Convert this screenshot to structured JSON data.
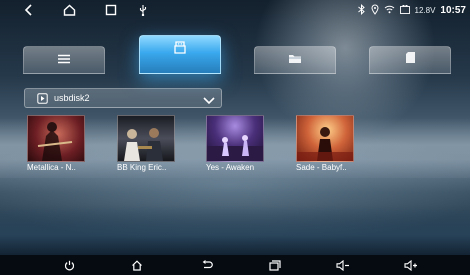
{
  "status_bar": {
    "nav_icons": [
      "back-icon",
      "home-icon",
      "recents-icon",
      "usb-icon"
    ],
    "battery_voltage": "12.8V",
    "time": "10:57"
  },
  "tabs": [
    {
      "icon": "list-icon",
      "active": false
    },
    {
      "icon": "usb-device-icon",
      "active": true
    },
    {
      "icon": "folder-icon",
      "active": false
    },
    {
      "icon": "sd-card-icon",
      "active": false
    }
  ],
  "source": {
    "label": "usbdisk2"
  },
  "videos": [
    {
      "caption": "Metallica - N..",
      "thumb_color": "#7a2a2a"
    },
    {
      "caption": "BB King  Eric..",
      "thumb_color": "#3a3a44"
    },
    {
      "caption": "Yes - Awaken",
      "thumb_color": "#4a2f6a"
    },
    {
      "caption": "Sade - Babyf..",
      "thumb_color": "#b04a2a"
    }
  ],
  "nav_bar": {
    "buttons": [
      "power-icon",
      "home-icon",
      "back-icon",
      "recents-icon",
      "volume-down-icon",
      "volume-up-icon"
    ]
  },
  "colors": {
    "active_tab": "#3aa9ee",
    "nav_bg": "#050b11"
  }
}
